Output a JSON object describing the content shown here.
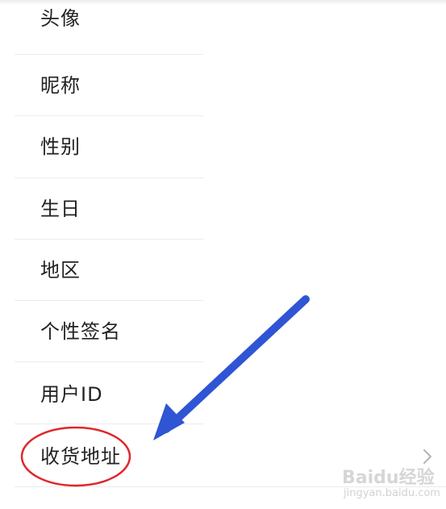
{
  "profile_menu": {
    "items": [
      {
        "label": "头像"
      },
      {
        "label": "昵称"
      },
      {
        "label": "性别"
      },
      {
        "label": "生日"
      },
      {
        "label": "地区"
      },
      {
        "label": "个性签名"
      },
      {
        "label": "用户ID"
      },
      {
        "label": "收货地址"
      }
    ],
    "chevron_icon": "chevron-right-icon"
  },
  "annotation": {
    "arrow_color": "#2f55d4",
    "circle_color": "#e0262b"
  },
  "watermark": {
    "logo": "Baidu经验",
    "url": "jingyan.baidu.com"
  }
}
